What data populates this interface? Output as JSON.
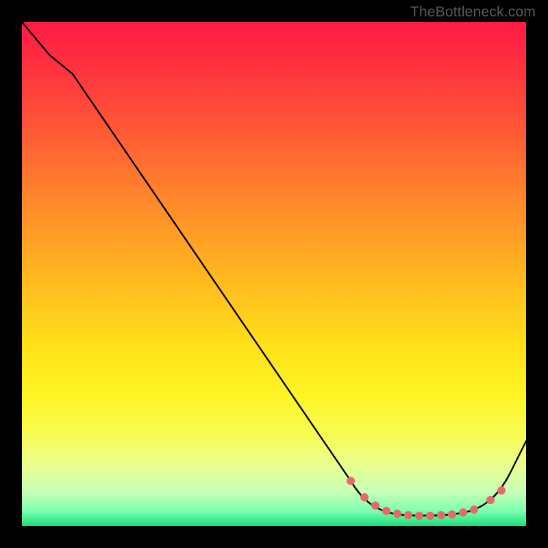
{
  "branding": {
    "text": "TheBottleneck.com"
  },
  "chart_data": {
    "type": "line",
    "title": "",
    "xlabel": "",
    "ylabel": "",
    "xlim": [
      0,
      100
    ],
    "ylim": [
      0,
      100
    ],
    "series": [
      {
        "name": "curve",
        "x": [
          0,
          5,
          10,
          20,
          30,
          40,
          50,
          60,
          65,
          68,
          72,
          76,
          80,
          84,
          88,
          90,
          94,
          100
        ],
        "y": [
          100,
          94,
          90,
          77,
          64,
          51,
          38,
          25,
          17,
          11,
          6,
          3,
          2,
          2,
          2,
          3,
          7,
          17
        ]
      }
    ],
    "markers": {
      "name": "flat-region-dots",
      "color": "#e56a6a",
      "x": [
        65,
        68,
        70,
        72,
        74,
        76,
        78,
        80,
        82,
        84,
        86,
        88,
        90,
        92
      ],
      "y": [
        12,
        7,
        5,
        4,
        3,
        2.5,
        2.2,
        2,
        2,
        2,
        2,
        2.3,
        3,
        5
      ]
    },
    "background_gradient": {
      "top": "#ff1a46",
      "mid": "#ffe019",
      "bottom": "#18e07a"
    }
  }
}
